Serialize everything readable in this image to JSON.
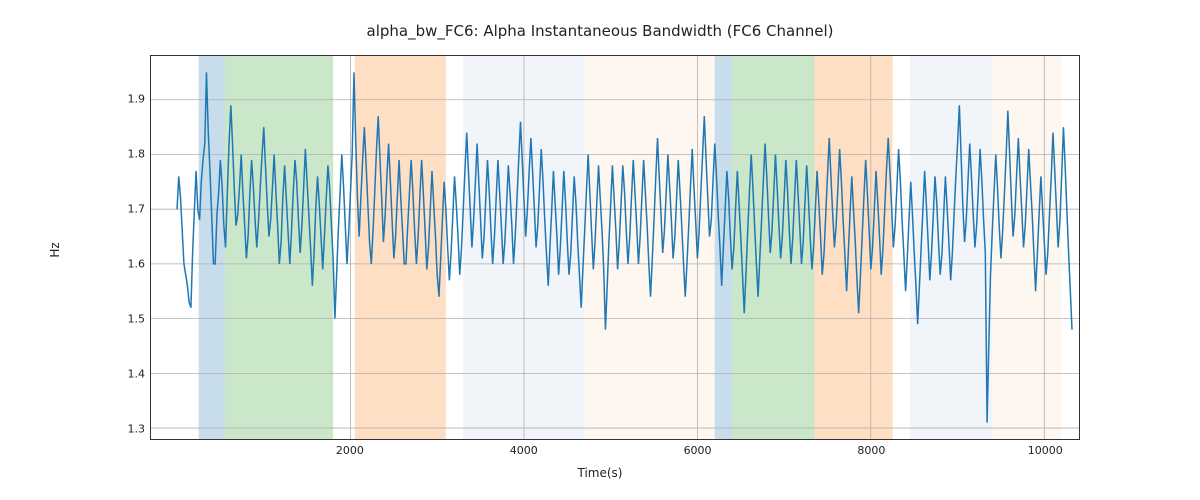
{
  "title": "alpha_bw_FC6: Alpha Instantaneous Bandwidth (FC6 Channel)",
  "xlabel": "Time(s)",
  "ylabel": "Hz",
  "x_ticks": [
    2000,
    4000,
    6000,
    8000,
    10000
  ],
  "y_ticks": [
    "1.3",
    "1.4",
    "1.5",
    "1.6",
    "1.7",
    "1.8",
    "1.9"
  ],
  "chart_data": {
    "type": "line",
    "title": "alpha_bw_FC6: Alpha Instantaneous Bandwidth (FC6 Channel)",
    "xlabel": "Time(s)",
    "ylabel": "Hz",
    "xlim": [
      -300,
      10400
    ],
    "ylim": [
      1.28,
      1.98
    ],
    "x_ticks": [
      2000,
      4000,
      6000,
      8000,
      10000
    ],
    "y_ticks": [
      1.3,
      1.4,
      1.5,
      1.6,
      1.7,
      1.8,
      1.9
    ],
    "grid": true,
    "shaded_bands": [
      {
        "start": 250,
        "end": 550,
        "color": "#1f77b4",
        "note": "blue"
      },
      {
        "start": 550,
        "end": 1800,
        "color": "#2ca02c",
        "note": "green"
      },
      {
        "start": 2050,
        "end": 3100,
        "color": "#ff7f0e",
        "note": "orange"
      },
      {
        "start": 3300,
        "end": 4700,
        "color": "#c9d4e6",
        "note": "light-blue"
      },
      {
        "start": 4700,
        "end": 6200,
        "color": "#fde0c5",
        "note": "light-peach"
      },
      {
        "start": 6200,
        "end": 6400,
        "color": "#1f77b4",
        "note": "blue"
      },
      {
        "start": 6400,
        "end": 7350,
        "color": "#2ca02c",
        "note": "green"
      },
      {
        "start": 7350,
        "end": 8250,
        "color": "#ff7f0e",
        "note": "orange"
      },
      {
        "start": 8450,
        "end": 9400,
        "color": "#c9d4e6",
        "note": "light-blue"
      },
      {
        "start": 9400,
        "end": 10200,
        "color": "#fde0c5",
        "note": "light-peach"
      }
    ],
    "series": [
      {
        "name": "alpha_bw_FC6",
        "color": "#1f77b4",
        "x_step": 20,
        "x_start": 0,
        "note": "y values estimated from dense noisy trace; length 512 spanning ~0..10220 s",
        "y": [
          1.7,
          1.76,
          1.72,
          1.66,
          1.6,
          1.58,
          1.56,
          1.53,
          1.52,
          1.62,
          1.7,
          1.77,
          1.7,
          1.68,
          1.75,
          1.79,
          1.82,
          1.95,
          1.84,
          1.77,
          1.69,
          1.6,
          1.6,
          1.69,
          1.73,
          1.79,
          1.74,
          1.67,
          1.63,
          1.73,
          1.82,
          1.89,
          1.82,
          1.74,
          1.67,
          1.69,
          1.74,
          1.8,
          1.73,
          1.67,
          1.61,
          1.65,
          1.73,
          1.79,
          1.74,
          1.68,
          1.63,
          1.68,
          1.74,
          1.8,
          1.85,
          1.78,
          1.71,
          1.65,
          1.68,
          1.74,
          1.8,
          1.73,
          1.67,
          1.6,
          1.64,
          1.72,
          1.78,
          1.72,
          1.66,
          1.6,
          1.66,
          1.73,
          1.79,
          1.75,
          1.68,
          1.62,
          1.67,
          1.74,
          1.81,
          1.75,
          1.69,
          1.63,
          1.56,
          1.62,
          1.7,
          1.76,
          1.71,
          1.65,
          1.59,
          1.65,
          1.72,
          1.78,
          1.74,
          1.67,
          1.61,
          1.5,
          1.58,
          1.66,
          1.73,
          1.8,
          1.74,
          1.67,
          1.6,
          1.66,
          1.73,
          1.8,
          1.95,
          1.83,
          1.72,
          1.65,
          1.72,
          1.79,
          1.85,
          1.78,
          1.71,
          1.64,
          1.6,
          1.66,
          1.73,
          1.81,
          1.87,
          1.79,
          1.72,
          1.64,
          1.69,
          1.76,
          1.82,
          1.75,
          1.68,
          1.61,
          1.65,
          1.72,
          1.79,
          1.72,
          1.66,
          1.6,
          1.6,
          1.67,
          1.73,
          1.79,
          1.73,
          1.66,
          1.6,
          1.65,
          1.72,
          1.79,
          1.73,
          1.66,
          1.59,
          1.63,
          1.7,
          1.77,
          1.71,
          1.65,
          1.58,
          1.54,
          1.61,
          1.68,
          1.75,
          1.7,
          1.63,
          1.57,
          1.62,
          1.69,
          1.76,
          1.71,
          1.65,
          1.58,
          1.63,
          1.7,
          1.77,
          1.84,
          1.77,
          1.7,
          1.63,
          1.68,
          1.75,
          1.82,
          1.75,
          1.68,
          1.61,
          1.65,
          1.72,
          1.79,
          1.73,
          1.66,
          1.6,
          1.65,
          1.72,
          1.79,
          1.73,
          1.67,
          1.6,
          1.64,
          1.71,
          1.78,
          1.73,
          1.67,
          1.6,
          1.65,
          1.72,
          1.79,
          1.86,
          1.79,
          1.72,
          1.65,
          1.7,
          1.77,
          1.83,
          1.77,
          1.7,
          1.63,
          1.67,
          1.74,
          1.81,
          1.75,
          1.68,
          1.62,
          1.56,
          1.63,
          1.7,
          1.77,
          1.71,
          1.65,
          1.58,
          1.63,
          1.7,
          1.77,
          1.71,
          1.64,
          1.58,
          1.62,
          1.69,
          1.76,
          1.71,
          1.64,
          1.58,
          1.52,
          1.59,
          1.66,
          1.73,
          1.8,
          1.73,
          1.66,
          1.59,
          1.64,
          1.71,
          1.78,
          1.72,
          1.66,
          1.59,
          1.48,
          1.56,
          1.64,
          1.71,
          1.78,
          1.72,
          1.66,
          1.59,
          1.64,
          1.71,
          1.78,
          1.73,
          1.66,
          1.6,
          1.65,
          1.72,
          1.79,
          1.73,
          1.67,
          1.6,
          1.65,
          1.72,
          1.79,
          1.73,
          1.67,
          1.6,
          1.54,
          1.61,
          1.68,
          1.76,
          1.83,
          1.76,
          1.69,
          1.62,
          1.66,
          1.73,
          1.8,
          1.74,
          1.68,
          1.61,
          1.65,
          1.72,
          1.79,
          1.73,
          1.67,
          1.6,
          1.54,
          1.6,
          1.67,
          1.74,
          1.81,
          1.74,
          1.68,
          1.61,
          1.66,
          1.73,
          1.8,
          1.87,
          1.79,
          1.72,
          1.65,
          1.68,
          1.75,
          1.82,
          1.76,
          1.69,
          1.63,
          1.56,
          1.63,
          1.7,
          1.77,
          1.72,
          1.65,
          1.59,
          1.63,
          1.7,
          1.77,
          1.71,
          1.65,
          1.58,
          1.51,
          1.58,
          1.66,
          1.73,
          1.8,
          1.74,
          1.67,
          1.6,
          1.54,
          1.61,
          1.68,
          1.75,
          1.82,
          1.76,
          1.69,
          1.62,
          1.66,
          1.73,
          1.8,
          1.74,
          1.67,
          1.61,
          1.65,
          1.72,
          1.79,
          1.73,
          1.66,
          1.6,
          1.65,
          1.72,
          1.79,
          1.73,
          1.67,
          1.6,
          1.64,
          1.71,
          1.78,
          1.72,
          1.65,
          1.59,
          1.63,
          1.7,
          1.77,
          1.71,
          1.65,
          1.58,
          1.62,
          1.69,
          1.76,
          1.83,
          1.76,
          1.69,
          1.63,
          1.67,
          1.74,
          1.81,
          1.75,
          1.68,
          1.62,
          1.55,
          1.62,
          1.69,
          1.76,
          1.7,
          1.64,
          1.57,
          1.51,
          1.58,
          1.65,
          1.72,
          1.79,
          1.73,
          1.66,
          1.59,
          1.63,
          1.7,
          1.77,
          1.71,
          1.65,
          1.58,
          1.63,
          1.7,
          1.77,
          1.83,
          1.77,
          1.7,
          1.63,
          1.67,
          1.74,
          1.81,
          1.75,
          1.68,
          1.62,
          1.55,
          1.61,
          1.68,
          1.75,
          1.69,
          1.62,
          1.56,
          1.49,
          1.56,
          1.63,
          1.7,
          1.77,
          1.71,
          1.64,
          1.57,
          1.62,
          1.69,
          1.76,
          1.71,
          1.64,
          1.58,
          1.62,
          1.69,
          1.76,
          1.7,
          1.64,
          1.57,
          1.62,
          1.69,
          1.76,
          1.82,
          1.89,
          1.8,
          1.71,
          1.64,
          1.68,
          1.75,
          1.82,
          1.76,
          1.69,
          1.63,
          1.67,
          1.74,
          1.81,
          1.75,
          1.68,
          1.62,
          1.31,
          1.45,
          1.58,
          1.66,
          1.73,
          1.8,
          1.74,
          1.67,
          1.61,
          1.66,
          1.73,
          1.8,
          1.88,
          1.8,
          1.72,
          1.65,
          1.69,
          1.76,
          1.83,
          1.76,
          1.7,
          1.63,
          1.67,
          1.74,
          1.81,
          1.75,
          1.69,
          1.62,
          1.55,
          1.62,
          1.69,
          1.76,
          1.7,
          1.64,
          1.58,
          1.62,
          1.69,
          1.76,
          1.84,
          1.77,
          1.7,
          1.63,
          1.68,
          1.76,
          1.85,
          1.78,
          1.7,
          1.62,
          1.55,
          1.48
        ]
      }
    ]
  }
}
